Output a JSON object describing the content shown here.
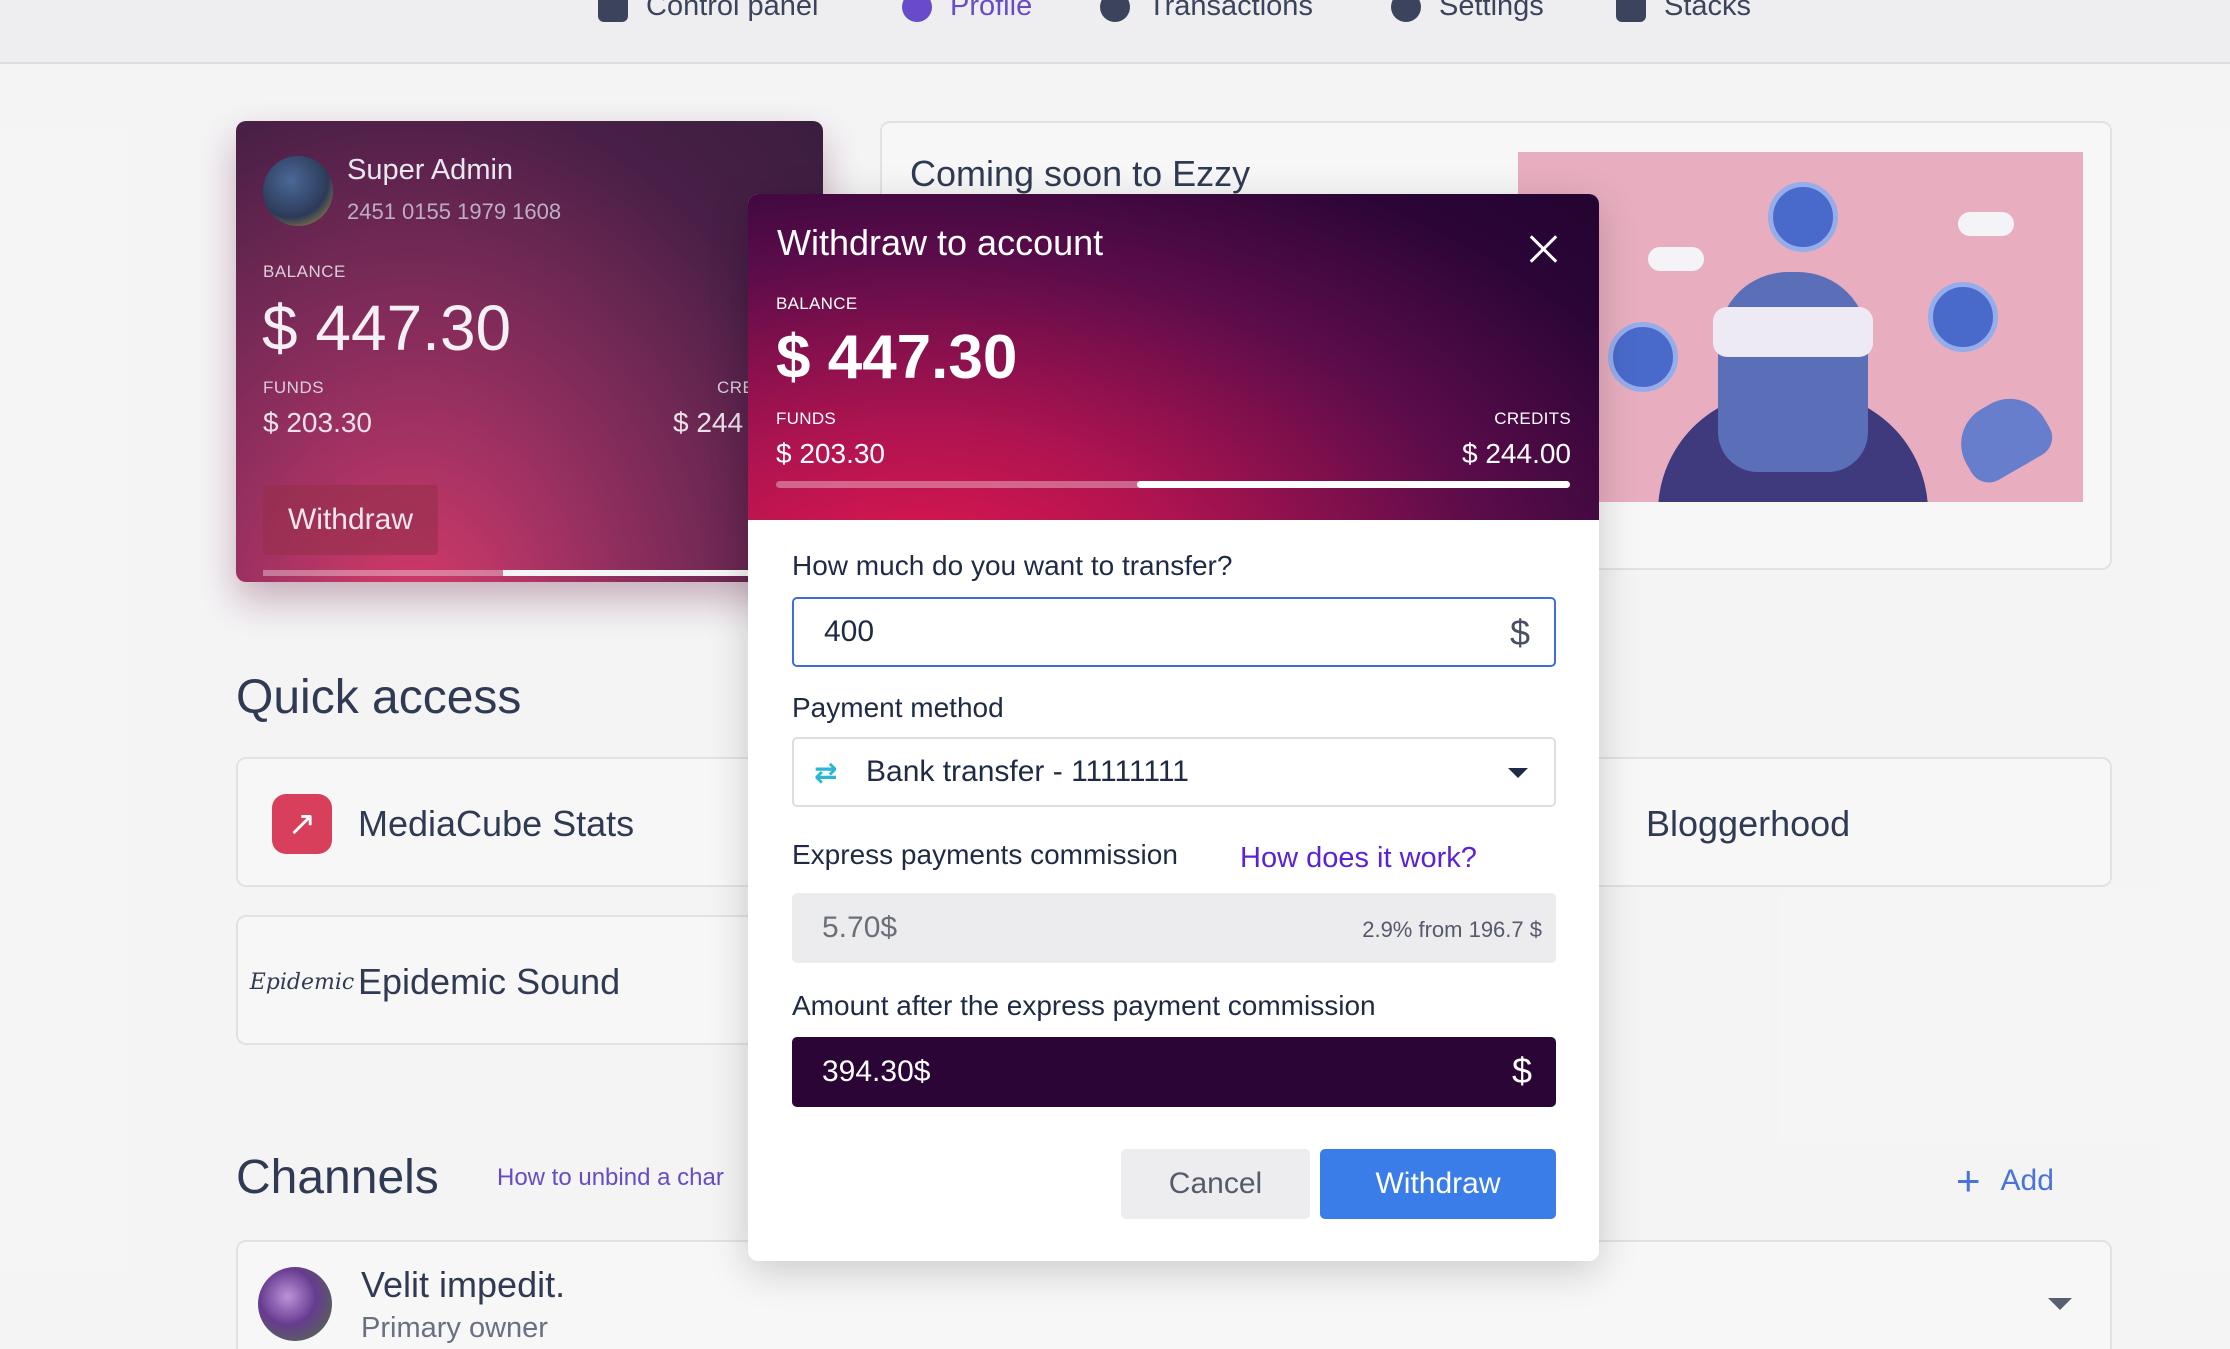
{
  "nav": {
    "items": [
      {
        "label": "Control panel",
        "icon": "id-card-icon"
      },
      {
        "label": "Profile",
        "icon": "user-circle-icon",
        "active": true
      },
      {
        "label": "Transactions",
        "icon": "exchange-icon"
      },
      {
        "label": "Settings",
        "icon": "gear-icon"
      },
      {
        "label": "Stacks",
        "icon": "clipboard-icon"
      }
    ]
  },
  "balance_card": {
    "name": "Super Admin",
    "account": "2451 0155 1979 1608",
    "balance_label": "BALANCE",
    "balance": "$ 447.30",
    "funds_label": "FUNDS",
    "funds": "$ 203.30",
    "credits_label": "CRE",
    "credits": "$ 244",
    "withdraw_label": "Withdraw"
  },
  "coming_soon": {
    "title": "Coming soon to Ezzy"
  },
  "quick_access": {
    "title": "Quick access",
    "items": [
      {
        "label": "MediaCube Stats",
        "icon": "trending-up-icon"
      },
      {
        "label": "Bloggerhood",
        "icon": "bloggerhood-icon"
      },
      {
        "label": "Epidemic Sound",
        "icon": "epidemic-logo-icon",
        "logo_text": "Epidemic"
      }
    ]
  },
  "channels": {
    "title": "Channels",
    "help_link": "How to unbind a char",
    "add_label": "Add",
    "items": [
      {
        "name": "Velit impedit.",
        "role": "Primary owner"
      }
    ]
  },
  "modal": {
    "title": "Withdraw to account",
    "balance_label": "BALANCE",
    "balance": "$ 447.30",
    "funds_label": "FUNDS",
    "funds": "$ 203.30",
    "credits_label": "CREDITS",
    "credits": "$ 244.00",
    "funds_share": 0.455,
    "amount_label": "How much do you want to transfer?",
    "amount_value": "400",
    "currency_symbol": "$",
    "method_label": "Payment method",
    "method_value": "Bank transfer - 11111111",
    "commission_label": "Express payments commission",
    "commission_link": "How does it work?",
    "commission_value": "5.70$",
    "commission_note": "2.9% from 196.7 $",
    "after_label": "Amount after the express payment commission",
    "after_value": "394.30$",
    "cancel_label": "Cancel",
    "withdraw_label": "Withdraw"
  },
  "colors": {
    "accent_blue": "#3a7de8",
    "brand_dark": "#2a0535",
    "brand_pink": "#e5174f",
    "link_purple": "#5a22d6"
  }
}
